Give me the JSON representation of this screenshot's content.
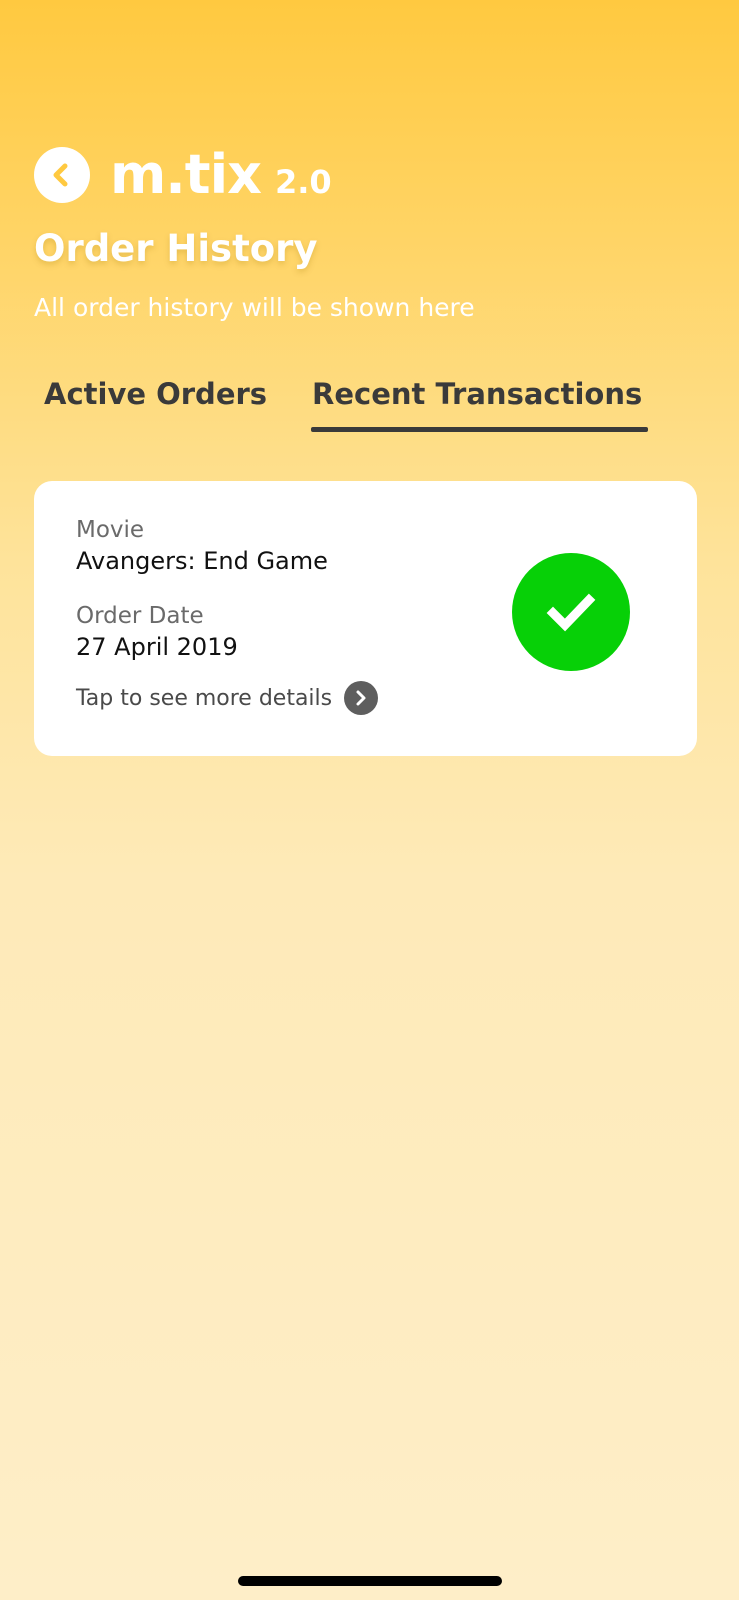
{
  "app": {
    "brand_name": "m.tix",
    "brand_version": "2.0",
    "back_icon": "chevron-left-icon"
  },
  "page": {
    "title": "Order History",
    "subtitle": "All order history will be shown here"
  },
  "tabs": [
    {
      "label": "Active Orders",
      "active": false
    },
    {
      "label": "Recent Transactions",
      "active": true
    }
  ],
  "orders": [
    {
      "movie_label": "Movie",
      "movie_value": "Avangers: End Game",
      "date_label": "Order Date",
      "date_value": "27 April 2019",
      "details_text": "Tap to see more details",
      "status_icon": "checkmark-icon",
      "status_color": "#07d007"
    }
  ],
  "colors": {
    "accent_yellow": "#ffc940",
    "tab_text": "#3a3a3a",
    "success_green": "#07d007"
  }
}
